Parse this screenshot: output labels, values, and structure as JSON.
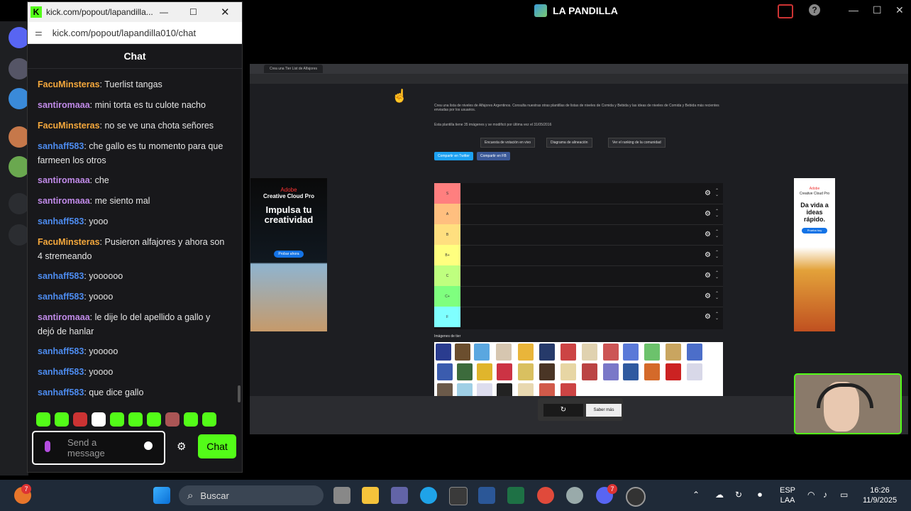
{
  "window": {
    "title": "LA PANDILLA"
  },
  "popup": {
    "title": "kick.com/popout/lapandilla...",
    "url": "kick.com/popout/lapandilla010/chat",
    "chat_header": "Chat"
  },
  "messages": [
    {
      "user": "FacuMinsteras",
      "color": "#f5a83c",
      "text": "Tuerlist tangas"
    },
    {
      "user": "santiromaaa",
      "color": "#c08ae8",
      "text": "mini torta es tu culote nacho"
    },
    {
      "user": "FacuMinsteras",
      "color": "#f5a83c",
      "text": "no se ve una chota señores"
    },
    {
      "user": "sanhaff583",
      "color": "#4d8cf0",
      "text": "che gallo es tu momento para que farmeen los otros"
    },
    {
      "user": "santiromaaa",
      "color": "#c08ae8",
      "text": "che"
    },
    {
      "user": "santiromaaa",
      "color": "#c08ae8",
      "text": "me siento mal"
    },
    {
      "user": "sanhaff583",
      "color": "#4d8cf0",
      "text": "yooo"
    },
    {
      "user": "FacuMinsteras",
      "color": "#f5a83c",
      "text": "Pusieron alfajores y ahora son 4 stremeando"
    },
    {
      "user": "sanhaff583",
      "color": "#4d8cf0",
      "text": "yoooooo"
    },
    {
      "user": "sanhaff583",
      "color": "#4d8cf0",
      "text": "yoooo"
    },
    {
      "user": "santiromaaa",
      "color": "#c08ae8",
      "text": "le dije lo del apellido a gallo y dejó de hanlar"
    },
    {
      "user": "sanhaff583",
      "color": "#4d8cf0",
      "text": "yooooo"
    },
    {
      "user": "sanhaff583",
      "color": "#4d8cf0",
      "text": "yoooo"
    },
    {
      "user": "sanhaff583",
      "color": "#4d8cf0",
      "text": "que dice gallo"
    }
  ],
  "input": {
    "placeholder": "Send a message",
    "send_label": "Chat"
  },
  "stream": {
    "tab_title": "Crea una Tier List de Alfajores",
    "intro": "Crea una lista de niveles de Alfajores Argentinos. Consulta nuestras otras plantillas de listas de niveles de Comida y Bebida y las ideas de niveles de Comida y Bebida más recientes enviadas por los usuarios.",
    "info": "Esta plantilla tiene 35 imágenes y se modificó por última vez el 31/05/2016",
    "buttons": [
      "Encuesta de votación en vivo",
      "Diagrama de alineación",
      "Ver el ranking de la comunidad"
    ],
    "share": [
      "Compartir en Twitter",
      "Compartir en FB"
    ],
    "tiers": [
      {
        "label": "S",
        "color": "#ff7f7f"
      },
      {
        "label": "A",
        "color": "#ffbf7f"
      },
      {
        "label": "B",
        "color": "#ffdf7f"
      },
      {
        "label": "B+",
        "color": "#ffff7f"
      },
      {
        "label": "C",
        "color": "#bfff7f"
      },
      {
        "label": "C+",
        "color": "#7fff7f"
      },
      {
        "label": "F",
        "color": "#7fffff"
      }
    ],
    "images_label": "Imágenes de tier",
    "ad_left": {
      "brand": "Adobe",
      "product": "Creative Cloud Pro",
      "headline": "Impulsa tu creatividad",
      "cta": "Probar ahora"
    },
    "ad_right": {
      "brand": "Adobe",
      "product": "Creative Cloud Pro",
      "headline": "Da vida a ideas rápido.",
      "cta": "Prueba hoy"
    },
    "bottom_button": "Saber más"
  },
  "taskbar": {
    "search_placeholder": "Buscar",
    "lang1": "ESP",
    "lang2": "LAA",
    "time": "16:26",
    "date": "11/9/2025",
    "badge_left": "7",
    "badge_discord": "7"
  }
}
